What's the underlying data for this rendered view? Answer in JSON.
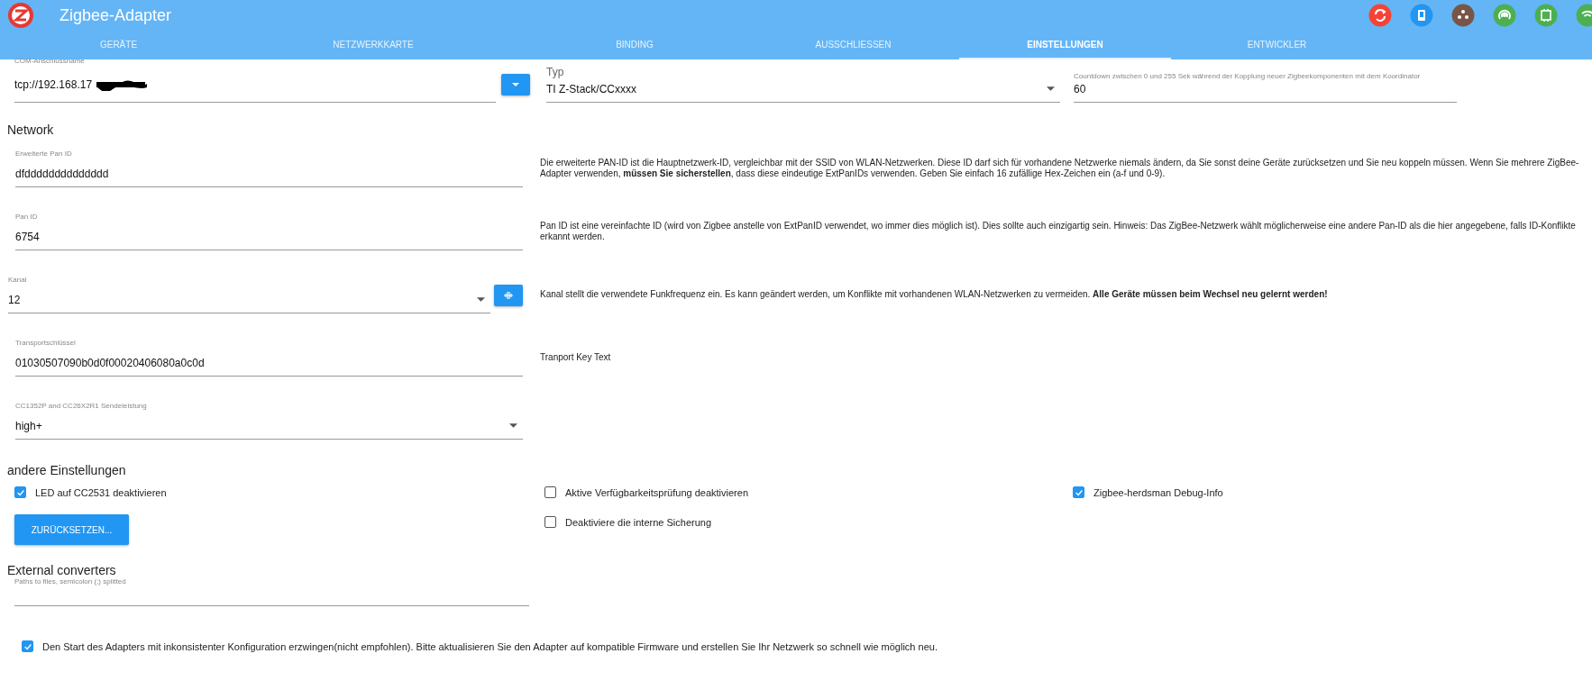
{
  "header": {
    "title": "Zigbee-Adapter"
  },
  "tabs": [
    {
      "label": "GERÄTE",
      "selected": false
    },
    {
      "label": "NETZWERKKARTE",
      "selected": false
    },
    {
      "label": "BINDING",
      "selected": false
    },
    {
      "label": "AUSSCHLIESSEN",
      "selected": false
    },
    {
      "label": "EINSTELLUNGEN",
      "selected": true
    },
    {
      "label": "ENTWICKLER",
      "selected": false
    }
  ],
  "top_fields": [
    {
      "kind": "port",
      "label": "COM-Anschlussname",
      "value": "tcp://192.168.17",
      "redacted": true
    },
    {
      "kind": "select",
      "label": "Typ",
      "value": "TI Z-Stack/CCxxxx"
    },
    {
      "kind": "text",
      "label": "Countdown zwischen 0 und 255 Sek während der Kopplung neuer Zigbeekomponenten mit dem Koordinator",
      "value": "60"
    }
  ],
  "network": {
    "heading": "Network",
    "rows": [
      {
        "kind": "text",
        "label": "Erweiterte Pan ID",
        "value": "dfdddddddddddddd",
        "help": "Die erweiterte PAN-ID ist die Hauptnetzwerk-ID, vergleichbar mit der SSID von WLAN-Netzwerken. Diese ID darf sich für vorhandene Netzwerke niemals ändern, da Sie sonst deine Geräte zurücksetzen und Sie neu koppeln müssen. Wenn Sie mehrere ZigBee-Adapter verwenden, **müssen Sie sicherstellen**, dass diese eindeutige ExtPanIDs verwenden. Geben Sie einfach 16 zufällige Hex-Zeichen ein (a-f und 0-9)."
      },
      {
        "kind": "text",
        "label": "Pan ID",
        "value": "6754",
        "help": "Pan ID ist eine vereinfachte ID (wird von Zigbee anstelle von ExtPanID verwendet, wo immer dies möglich ist). Dies sollte auch einzigartig sein. Hinweis: Das ZigBee-Netzwerk wählt möglicherweise eine andere Pan-ID als die hier angegebene, falls ID-Konflikte erkannt werden."
      },
      {
        "kind": "channel",
        "label": "Kanal",
        "value": "12",
        "help": "Kanal stellt die verwendete Funkfrequenz ein. Es kann geändert werden, um Konflikte mit vorhandenen WLAN-Netzwerken zu vermeiden. **Alle Geräte müssen beim Wechsel neu gelernt werden!**"
      },
      {
        "kind": "text",
        "label": "Transportschlüssel",
        "value": "01030507090b0d0f00020406080a0c0d",
        "help": "Tranport Key Text"
      },
      {
        "kind": "select",
        "label": "CC1352P and CC26X2R1 Sendeleistung",
        "value": "high+"
      }
    ]
  },
  "other": {
    "heading": "andere Einstellungen",
    "columns": [
      [
        {
          "label": "LED auf CC2531 deaktivieren",
          "checked": true
        }
      ],
      [
        {
          "label": "Aktive Verfügbarkeitsprüfung deaktivieren",
          "checked": false
        },
        {
          "label": "Deaktiviere die interne Sicherung",
          "checked": false
        }
      ],
      [
        {
          "label": "Zigbee-herdsman Debug-Info",
          "checked": true
        }
      ]
    ],
    "reset_button": "ZURÜCKSETZEN..."
  },
  "converters": {
    "heading": "External converters",
    "label": "Paths to files, semicolon (;) splitted"
  },
  "force_start": {
    "label": "Den Start des Adapters mit inkonsistenter Konfiguration erzwingen(nicht empfohlen). Bitte aktualisieren Sie den Adapter auf kompatible Firmware und erstellen Sie Ihr Netzwerk so schnell wie möglich neu.",
    "checked": true
  }
}
